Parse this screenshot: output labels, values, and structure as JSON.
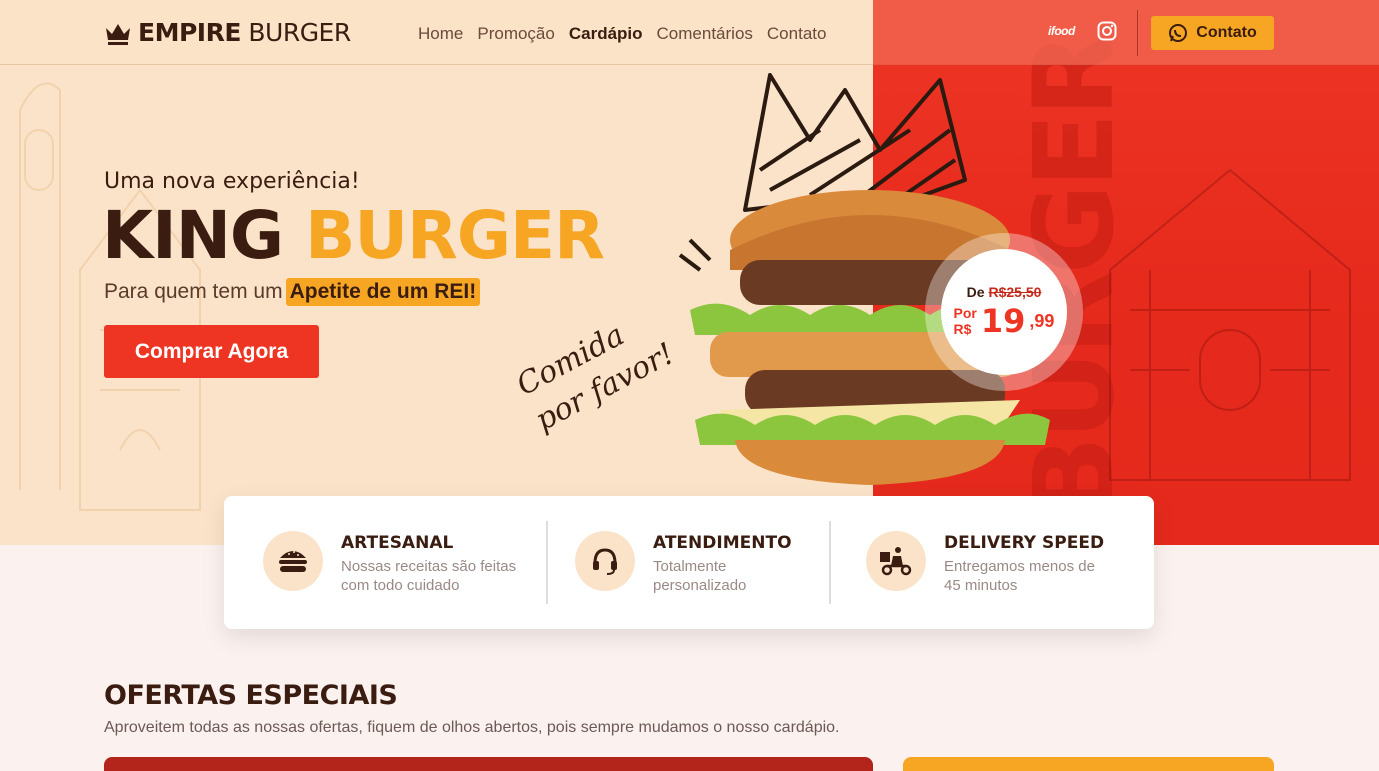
{
  "brand": {
    "name_bold": "EMPIRE",
    "name_light": " BURGER"
  },
  "nav": [
    {
      "label": "Home",
      "active": false
    },
    {
      "label": "Promoção",
      "active": false
    },
    {
      "label": "Cardápio",
      "active": true
    },
    {
      "label": "Comentários",
      "active": false
    },
    {
      "label": "Contato",
      "active": false
    }
  ],
  "header": {
    "ifood_label": "ifood",
    "contact_button": "Contato"
  },
  "hero": {
    "subtitle": "Uma nova experiência!",
    "title_part1": "KING ",
    "title_part2": "BURGER",
    "desc_prefix": "Para quem tem um",
    "desc_highlight": "Apetite de um REI!",
    "cta": "Comprar Agora",
    "note_line1": "Comida",
    "note_line2": "por favor!",
    "side_text": "BURGER"
  },
  "price": {
    "old_prefix": "De",
    "old_value": "R$25,50",
    "new_prefix_line1": "Por",
    "new_prefix_line2": "R$",
    "new_value": "19",
    "new_cents": ",99"
  },
  "features": [
    {
      "icon": "burger-icon",
      "title": "ARTESANAL",
      "desc": "Nossas receitas são feitas com todo cuidado"
    },
    {
      "icon": "headset-icon",
      "title": "ATENDIMENTO",
      "desc": "Totalmente personalizado"
    },
    {
      "icon": "delivery-icon",
      "title": "DELIVERY SPEED",
      "desc": "Entregamos menos de 45 minutos"
    }
  ],
  "offers": {
    "title": "OFERTAS ESPECIAIS",
    "desc": "Aproveitem todas as nossas ofertas, fiquem de olhos abertos, pois sempre mudamos o nosso cardápio."
  },
  "colors": {
    "brown": "#3a1d10",
    "orange": "#f6a623",
    "red": "#ee3524",
    "cream": "#fbe3c9"
  }
}
